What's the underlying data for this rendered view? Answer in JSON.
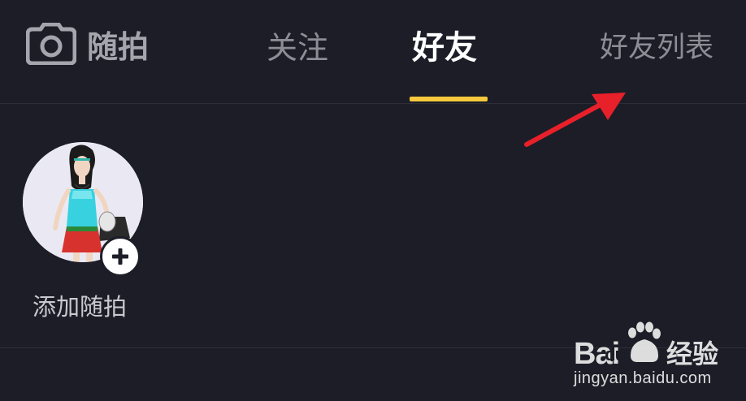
{
  "header": {
    "camera_label": "随拍",
    "tabs": [
      {
        "label": "关注",
        "active": false
      },
      {
        "label": "好友",
        "active": true
      },
      {
        "label": "好友列表",
        "active": false
      }
    ],
    "active_indicator_color": "#f5c93b"
  },
  "content": {
    "add_label": "添加随拍"
  },
  "watermark": {
    "brand": "Bai",
    "brand_du": "du",
    "jingyan": "经验",
    "url": "jingyan.baidu.com"
  },
  "colors": {
    "background": "#1c1d27",
    "arrow": "#e8202a"
  },
  "icons": {
    "camera": "camera-icon",
    "add": "plus-icon",
    "arrow": "red-arrow-annotation"
  }
}
